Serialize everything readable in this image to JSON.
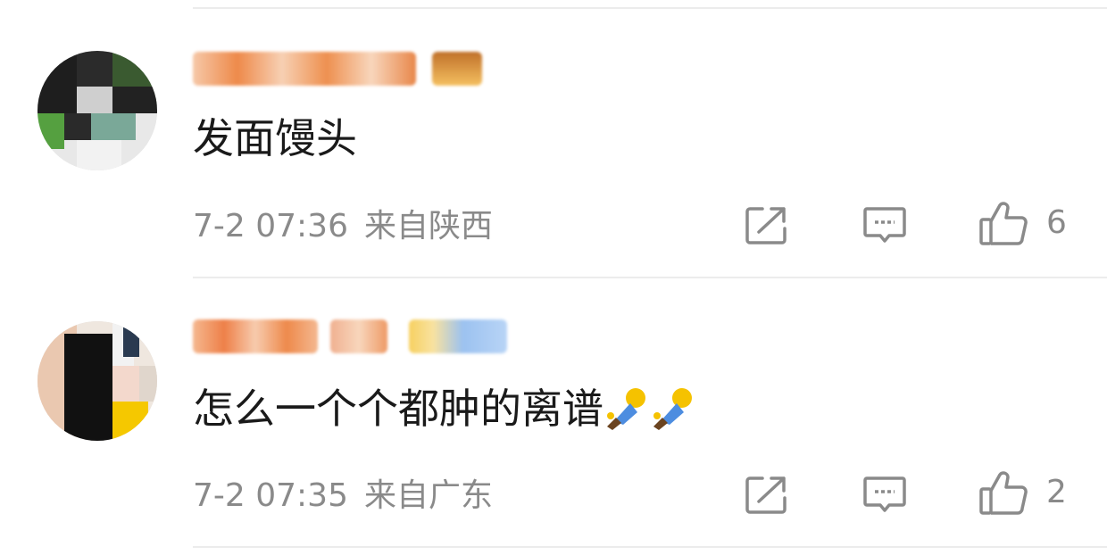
{
  "comments": [
    {
      "username": "",
      "text": "发面馒头",
      "time": "7-2 07:36",
      "location": "来自陕西",
      "likes": "6"
    },
    {
      "username": "",
      "text": "怎么一个个都肿的离谱",
      "time": "7-2 07:35",
      "location": "来自广东",
      "likes": "2"
    }
  ],
  "icons": {
    "share": "share-icon",
    "comment": "comment-icon",
    "like": "thumbs-up-icon",
    "emoji": "hug-emoji"
  },
  "colors": {
    "text": "#1a1a1a",
    "meta": "#8a8a8a",
    "divider": "#ececec",
    "username_blur": "#f0a070"
  }
}
